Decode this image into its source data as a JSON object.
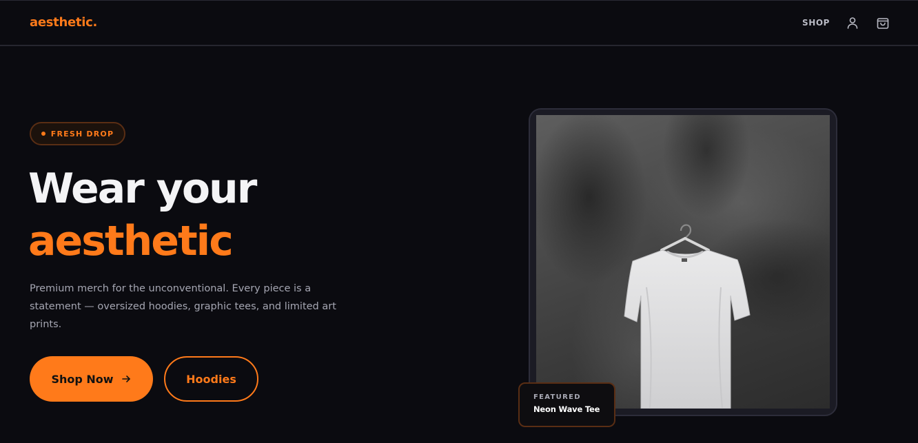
{
  "header": {
    "logo": "aesthetic.",
    "nav_shop": "SHOP",
    "account_icon": "user-icon",
    "cart_icon": "shopping-bag-icon"
  },
  "hero": {
    "badge": "FRESH DROP",
    "title_line1": "Wear your",
    "title_line2": "aesthetic",
    "description": "Premium merch for the unconventional. Every piece is a statement — oversized hoodies, graphic tees, and limited art prints.",
    "primary_button": "Shop Now",
    "primary_button_icon": "arrow-right-icon",
    "secondary_button": "Hoodies"
  },
  "featured": {
    "label": "FEATURED",
    "product_name": "Neon Wave Tee"
  },
  "colors": {
    "background": "#0b0b10",
    "accent": "#ff7a1a",
    "text": "#f4f4f6",
    "muted": "#a5a6b2"
  }
}
